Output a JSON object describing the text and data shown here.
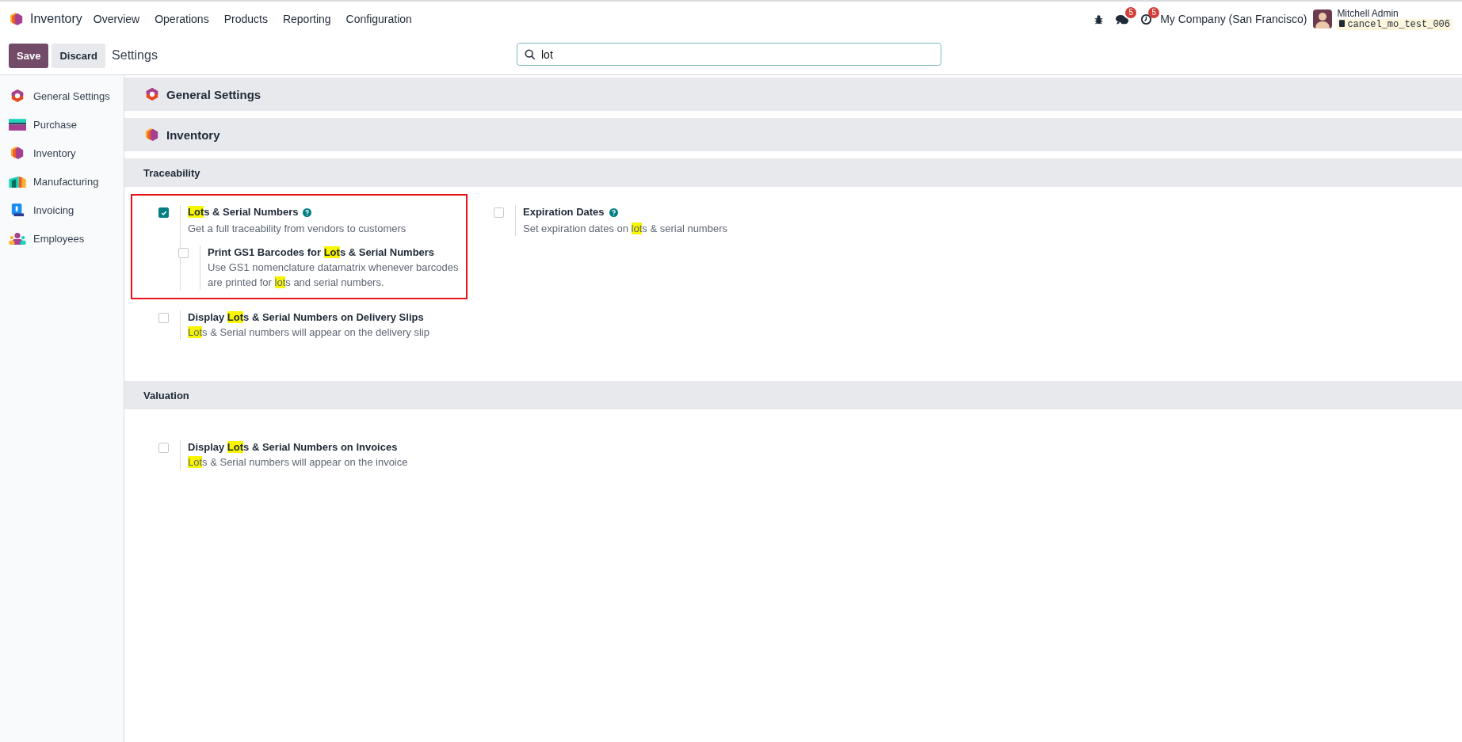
{
  "navbar": {
    "app_name": "Inventory",
    "menu": [
      "Overview",
      "Operations",
      "Products",
      "Reporting",
      "Configuration"
    ],
    "systray": {
      "messages_badge": "5",
      "activities_badge": "5",
      "company": "My Company (San Francisco)",
      "user_name": "Mitchell Admin",
      "database": "cancel_mo_test_006"
    }
  },
  "control_panel": {
    "buttons": [
      {
        "label": "Save",
        "kind": "primary"
      },
      {
        "label": "Discard",
        "kind": "secondary"
      }
    ],
    "title": "Settings",
    "search": {
      "value": "lot"
    }
  },
  "sidebar": {
    "items": [
      {
        "label": "General Settings",
        "kind": "general"
      },
      {
        "label": "Purchase",
        "kind": "purchase"
      },
      {
        "label": "Inventory",
        "kind": "inventory"
      },
      {
        "label": "Manufacturing",
        "kind": "manufacturing"
      },
      {
        "label": "Invoicing",
        "kind": "invoicing"
      },
      {
        "label": "Employees",
        "kind": "employees"
      }
    ]
  },
  "app_sections": [
    {
      "title": "General Settings",
      "kind": "general"
    },
    {
      "title": "Inventory",
      "kind": "inventory"
    }
  ],
  "groups": [
    {
      "title": "Traceability",
      "settings": [
        {
          "label": [
            {
              "text": "Lot",
              "highlight": true
            },
            {
              "text": "s & Serial Numbers",
              "highlight": false
            }
          ],
          "description": [
            {
              "text": "Get a full traceability from vendors to customers",
              "highlight": false
            }
          ],
          "checked": true,
          "help": true,
          "outlined": true,
          "children": [
            {
              "label": [
                {
                  "text": "Print GS1 Barcodes for ",
                  "highlight": false
                },
                {
                  "text": "Lot",
                  "highlight": true
                },
                {
                  "text": "s & Serial Numbers",
                  "highlight": false
                }
              ],
              "description": [
                {
                  "text": "Use GS1 nomenclature datamatrix whenever barcodes are printed for ",
                  "highlight": false
                },
                {
                  "text": "lot",
                  "highlight": true
                },
                {
                  "text": "s and serial numbers.",
                  "highlight": false
                }
              ],
              "checked": false,
              "help": false,
              "outlined": false
            }
          ]
        },
        {
          "label": [
            {
              "text": "Expiration Dates",
              "highlight": false
            }
          ],
          "description": [
            {
              "text": "Set expiration dates on ",
              "highlight": false
            },
            {
              "text": "lot",
              "highlight": true
            },
            {
              "text": "s & serial numbers",
              "highlight": false
            }
          ],
          "checked": false,
          "help": true,
          "outlined": false
        },
        {
          "label": [
            {
              "text": "Display ",
              "highlight": false
            },
            {
              "text": "Lot",
              "highlight": true
            },
            {
              "text": "s & Serial Numbers on Delivery Slips",
              "highlight": false
            }
          ],
          "description": [
            {
              "text": "Lot",
              "highlight": true
            },
            {
              "text": "s & Serial numbers will appear on the delivery slip",
              "highlight": false
            }
          ],
          "checked": false,
          "help": false,
          "outlined": false
        }
      ]
    },
    {
      "title": "Valuation",
      "settings": [
        {
          "label": [
            {
              "text": "Display ",
              "highlight": false
            },
            {
              "text": "Lot",
              "highlight": true
            },
            {
              "text": "s & Serial Numbers on Invoices",
              "highlight": false
            }
          ],
          "description": [
            {
              "text": "Lot",
              "highlight": true
            },
            {
              "text": "s & Serial numbers will appear on the invoice",
              "highlight": false
            }
          ],
          "checked": false,
          "help": false,
          "outlined": false
        }
      ]
    }
  ]
}
